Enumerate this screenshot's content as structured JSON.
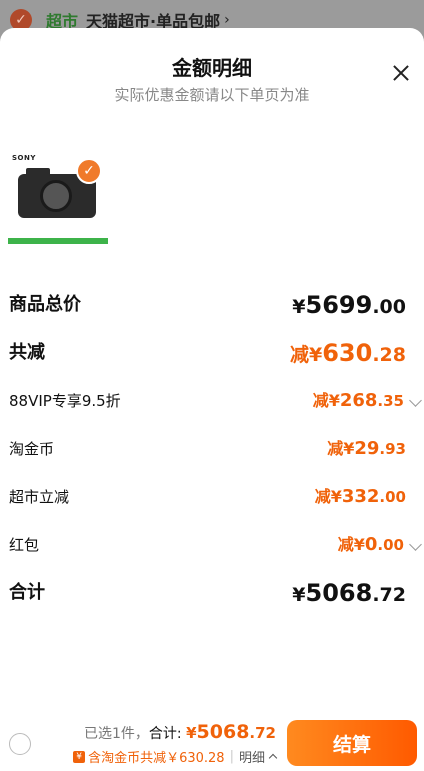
{
  "background": {
    "tag": "超市",
    "text": "天猫超市·单品包邮",
    "chevron": "›"
  },
  "sheet": {
    "title": "金额明细",
    "subtitle": "实际优惠金额请以下单页为准"
  },
  "product": {
    "brand": "SONY",
    "selected": true
  },
  "rows": {
    "subtotal": {
      "label": "商品总价",
      "currency": "¥",
      "int": "5699",
      "dec": ".00"
    },
    "total_discount": {
      "label": "共减",
      "prefix": "减¥",
      "int": "630",
      "dec": ".28"
    },
    "vip": {
      "label": "88VIP专享9.5折",
      "prefix": "减¥",
      "int": "268",
      "dec": ".35"
    },
    "coin": {
      "label": "淘金币",
      "prefix": "减¥",
      "int": "29",
      "dec": ".93"
    },
    "instant": {
      "label": "超市立减",
      "prefix": "减¥",
      "int": "332",
      "dec": ".00"
    },
    "redpacket": {
      "label": "红包",
      "prefix": "减¥",
      "int": "0",
      "dec": ".00"
    },
    "total": {
      "label": "合计",
      "currency": "¥",
      "int": "5068",
      "dec": ".72"
    }
  },
  "bottom": {
    "selected_text": "已选1件，",
    "total_label": "合计: ",
    "currency": "¥",
    "int": "5068",
    "dec": ".72",
    "coin_icon": "¥",
    "discount_text": "含淘金币共减￥630.28",
    "separator": "|",
    "detail_label": "明细",
    "checkout_label": "结算"
  },
  "colors": {
    "accent": "#f0620a",
    "checkout_gradient_start": "#ff8a1f",
    "checkout_gradient_end": "#ff5a00"
  }
}
